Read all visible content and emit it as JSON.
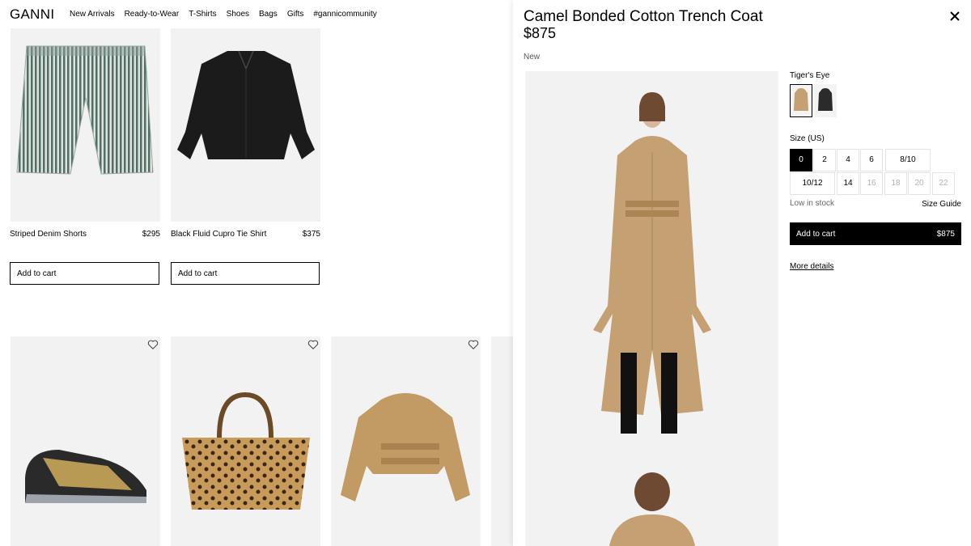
{
  "header": {
    "logo": "GANNI",
    "nav": [
      "New Arrivals",
      "Ready-to-Wear",
      "T-Shirts",
      "Shoes",
      "Bags",
      "Gifts",
      "#gannicommunity"
    ]
  },
  "products": [
    {
      "name": "Striped Denim Shorts",
      "price": "$295",
      "button": "Add to cart"
    },
    {
      "name": "Black Fluid Cupro Tie Shirt",
      "price": "$375",
      "button": "Add to cart"
    }
  ],
  "drawer": {
    "title": "Camel Bonded Cotton Trench Coat",
    "price": "$875",
    "badge": "New",
    "color_label": "Tiger's Eye",
    "size_label": "Size (US)",
    "sizes": [
      "0",
      "2",
      "4",
      "6",
      "8/10",
      "10/12",
      "14",
      "16",
      "18",
      "20",
      "22"
    ],
    "stock": "Low in stock",
    "size_guide": "Size Guide",
    "cart_label": "Add to cart",
    "cart_price": "$875",
    "more": "More details"
  },
  "colors": {
    "camel": "#c4a073",
    "black": "#000000",
    "image_bg": "#f2f2f2"
  }
}
